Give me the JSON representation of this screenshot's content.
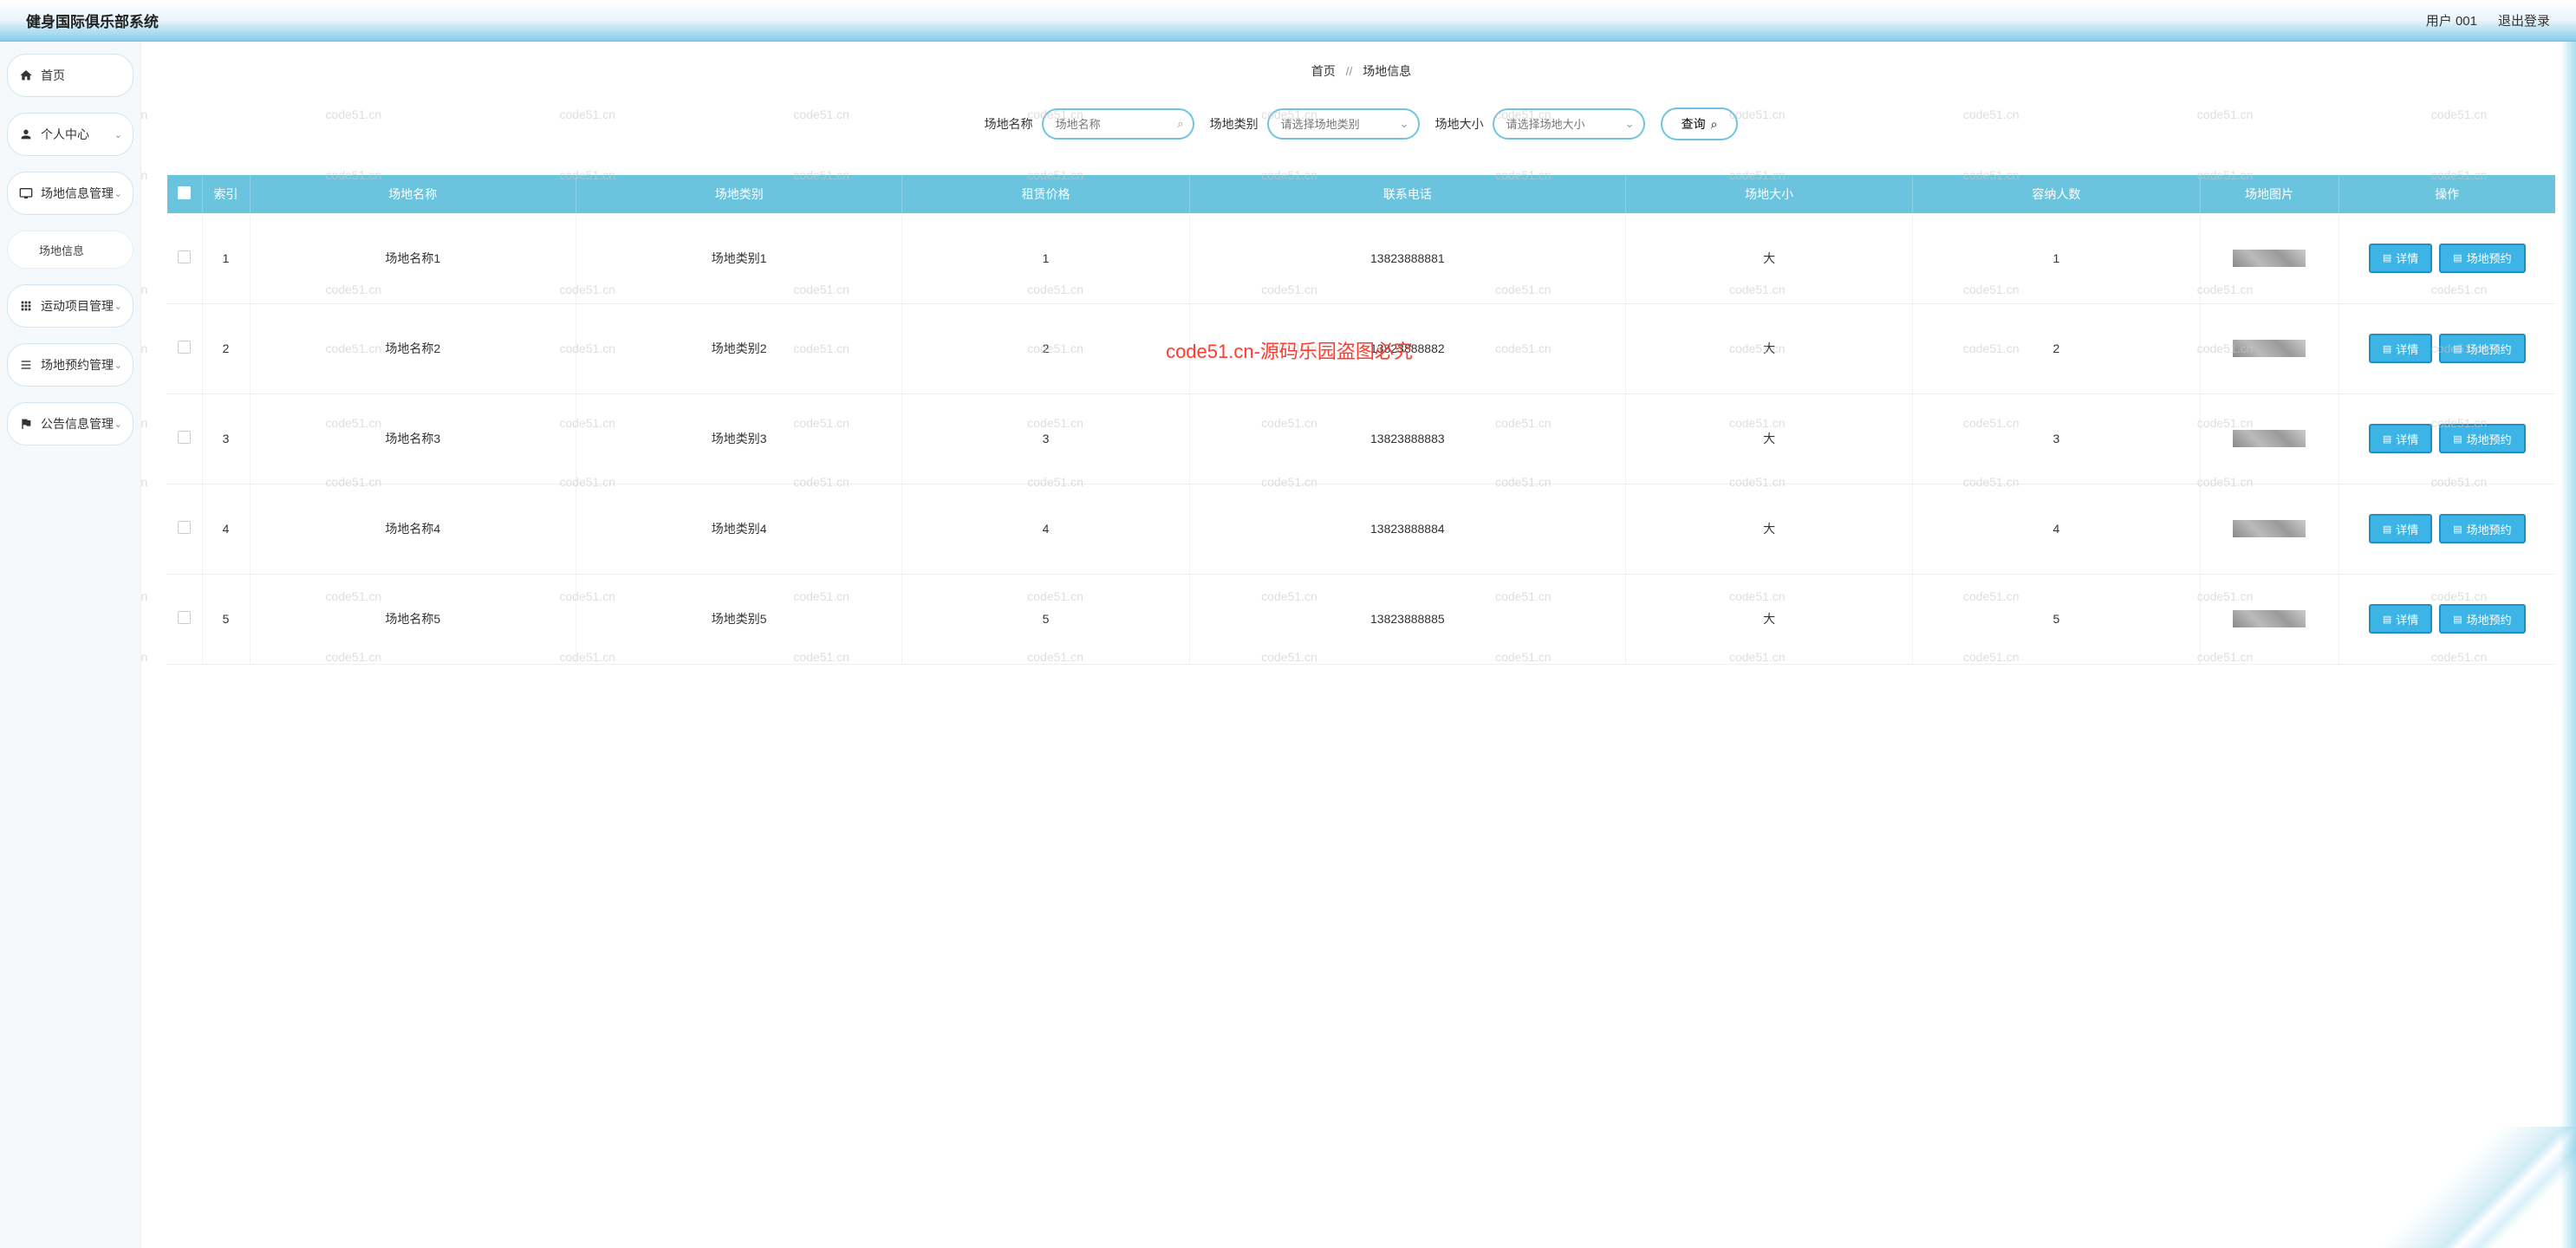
{
  "header": {
    "title": "健身国际俱乐部系统",
    "user": "用户 001",
    "logout": "退出登录"
  },
  "sidebar": {
    "home": "首页",
    "personal": "个人中心",
    "venue_mgmt": "场地信息管理",
    "venue_info": "场地信息",
    "sport_mgmt": "运动项目管理",
    "reserve_mgmt": "场地预约管理",
    "notice_mgmt": "公告信息管理"
  },
  "breadcrumb": {
    "home": "首页",
    "sep": "//",
    "current": "场地信息"
  },
  "search": {
    "name_label": "场地名称",
    "name_placeholder": "场地名称",
    "type_label": "场地类别",
    "type_placeholder": "请选择场地类别",
    "size_label": "场地大小",
    "size_placeholder": "请选择场地大小",
    "query": "查询"
  },
  "table": {
    "headers": {
      "index": "索引",
      "name": "场地名称",
      "type": "场地类别",
      "price": "租赁价格",
      "phone": "联系电话",
      "size": "场地大小",
      "capacity": "容纳人数",
      "image": "场地图片",
      "action": "操作"
    },
    "detail_btn": "详情",
    "reserve_btn": "场地预约",
    "rows": [
      {
        "index": "1",
        "name": "场地名称1",
        "type": "场地类别1",
        "price": "1",
        "phone": "13823888881",
        "size": "大",
        "capacity": "1"
      },
      {
        "index": "2",
        "name": "场地名称2",
        "type": "场地类别2",
        "price": "2",
        "phone": "13823888882",
        "size": "大",
        "capacity": "2"
      },
      {
        "index": "3",
        "name": "场地名称3",
        "type": "场地类别3",
        "price": "3",
        "phone": "13823888883",
        "size": "大",
        "capacity": "3"
      },
      {
        "index": "4",
        "name": "场地名称4",
        "type": "场地类别4",
        "price": "4",
        "phone": "13823888884",
        "size": "大",
        "capacity": "4"
      },
      {
        "index": "5",
        "name": "场地名称5",
        "type": "场地类别5",
        "price": "5",
        "phone": "13823888885",
        "size": "大",
        "capacity": "5"
      }
    ]
  },
  "watermark": {
    "text": "code51.cn",
    "red": "code51.cn-源码乐园盗图必究"
  }
}
